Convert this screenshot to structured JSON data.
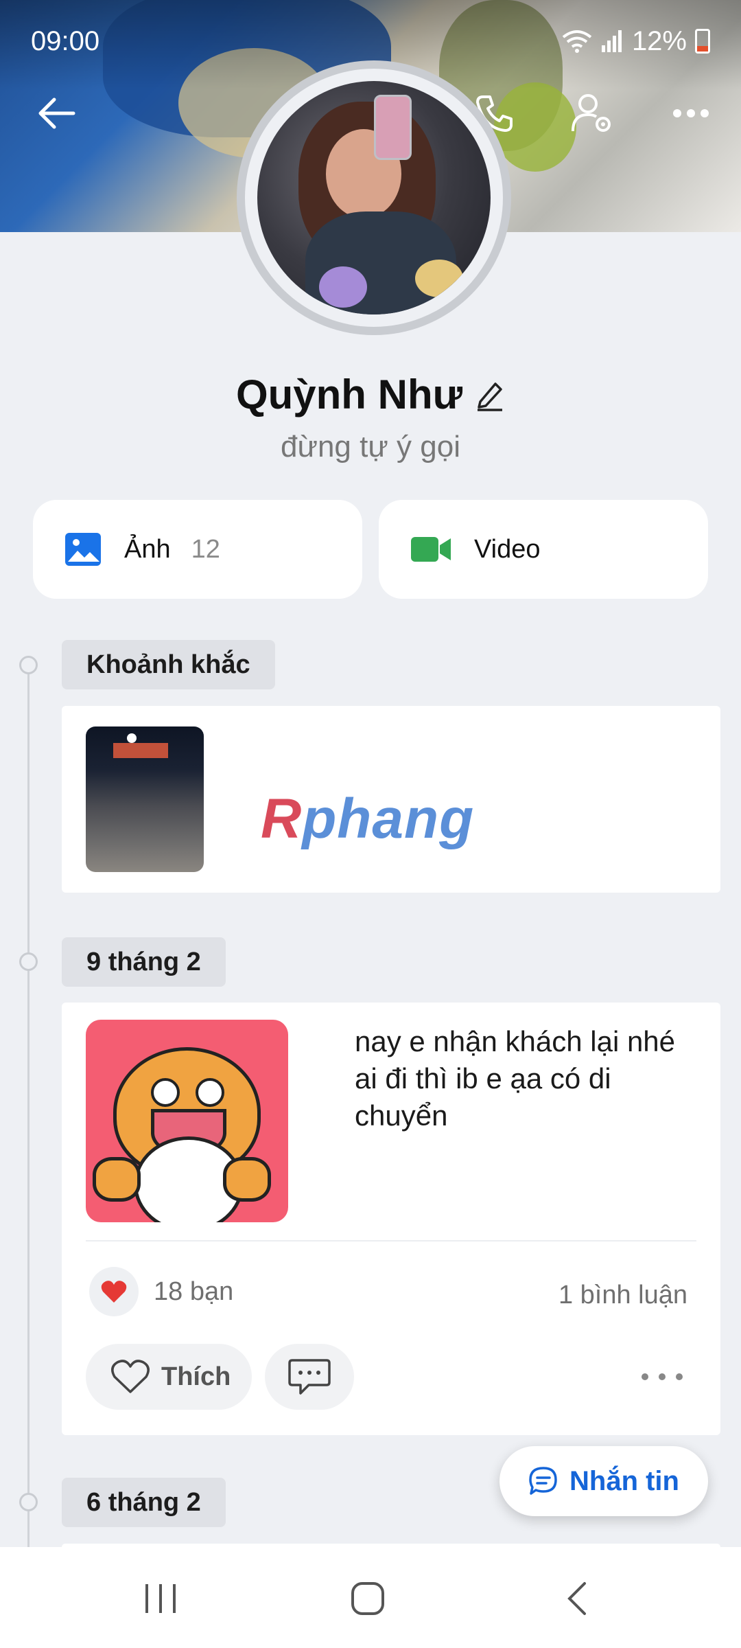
{
  "status_bar": {
    "time": "09:00",
    "battery": "12%"
  },
  "header": {
    "back_icon": "arrow-left-icon",
    "call_icon": "phone-icon",
    "settings_icon": "user-settings-icon",
    "more_icon": "more-horizontal-icon"
  },
  "profile": {
    "name": "Quỳnh Như",
    "bio": "đừng tự ý gọi"
  },
  "media": {
    "photos_label": "Ảnh",
    "photos_count": "12",
    "video_label": "Video"
  },
  "timeline": {
    "moments_label": "Khoảnh khắc",
    "moment_watermark": "Rphang",
    "date1": "9 tháng 2",
    "date2": "6 tháng 2"
  },
  "post": {
    "text": "nay e nhận khách lại nhé ai đi thì ib e ạa có di chuyển",
    "reaction_count": "18 bạn",
    "comment_count": "1 bình luận",
    "like_label": "Thích"
  },
  "fab": {
    "label": "Nhắn tin"
  },
  "colors": {
    "accent": "#1565d8",
    "photo_icon": "#1a73e8",
    "video_icon": "#34a853",
    "heart": "#e53935"
  }
}
